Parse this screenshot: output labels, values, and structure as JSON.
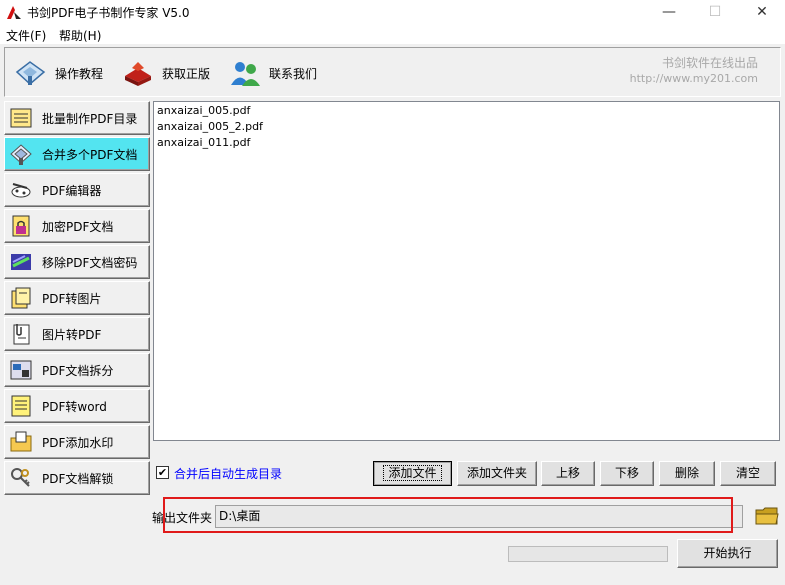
{
  "window": {
    "title": "书剑PDF电子书制作专家 V5.0",
    "controls": {
      "minimize": "—",
      "maximize": "☐",
      "close": "✕"
    }
  },
  "menu": {
    "file": "文件(F)",
    "help": "帮助(H)"
  },
  "toolbar": {
    "tutorial": "操作教程",
    "buy": "获取正版",
    "contact": "联系我们",
    "brand_name": "书剑软件在线出品",
    "brand_url": "http://www.my201.com"
  },
  "sidebar": {
    "items": [
      {
        "label": "批量制作PDF目录",
        "icon": "notepad-icon",
        "active": false
      },
      {
        "label": "合并多个PDF文档",
        "icon": "merge-pages-icon",
        "active": true
      },
      {
        "label": "PDF编辑器",
        "icon": "edit-icon",
        "active": false
      },
      {
        "label": "加密PDF文档",
        "icon": "lock-document-icon",
        "active": false
      },
      {
        "label": "移除PDF文档密码",
        "icon": "remove-password-icon",
        "active": false
      },
      {
        "label": "PDF转图片",
        "icon": "image-icon",
        "active": false
      },
      {
        "label": "图片转PDF",
        "icon": "document-clip-icon",
        "active": false
      },
      {
        "label": "PDF文档拆分",
        "icon": "split-icon",
        "active": false
      },
      {
        "label": "PDF转word",
        "icon": "word-note-icon",
        "active": false
      },
      {
        "label": "PDF添加水印",
        "icon": "watermark-folder-icon",
        "active": false
      },
      {
        "label": "PDF文档解锁",
        "icon": "keys-icon",
        "active": false
      }
    ]
  },
  "files": [
    "anxaizai_005.pdf",
    "anxaizai_005_2.pdf",
    "anxaizai_011.pdf"
  ],
  "options": {
    "auto_toc_label": "合并后自动生成目录",
    "auto_toc_checked": true,
    "check_mark": "✔"
  },
  "actions": {
    "add_file": "添加文件",
    "add_folder": "添加文件夹",
    "move_up": "上移",
    "move_down": "下移",
    "delete": "删除",
    "clear": "清空"
  },
  "output": {
    "label": "输出文件夹",
    "path": "D:\\桌面"
  },
  "progress": {
    "value": 0
  },
  "start": "开始执行"
}
